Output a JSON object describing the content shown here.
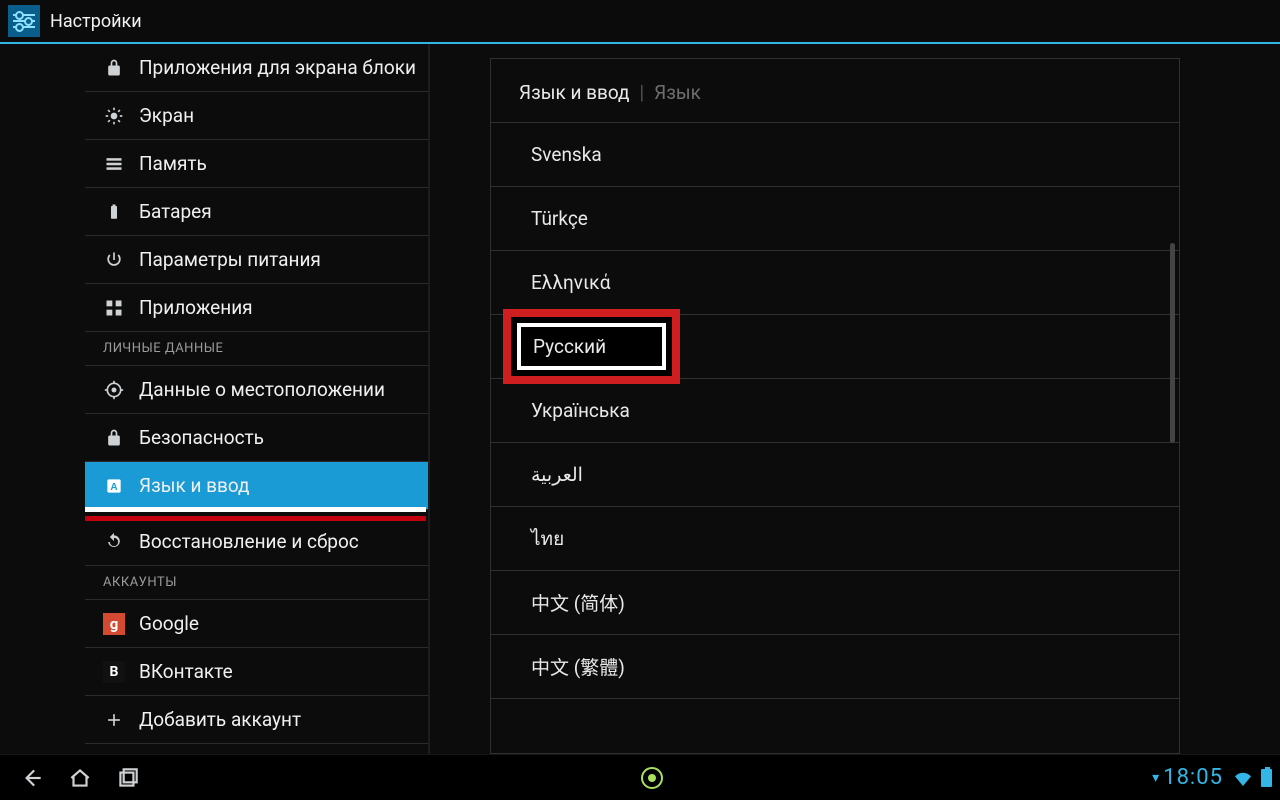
{
  "titlebar": {
    "title": "Настройки"
  },
  "sidebar": {
    "items": [
      {
        "icon": "lock",
        "label": "Приложения для экрана блоки"
      },
      {
        "icon": "brightness",
        "label": "Экран"
      },
      {
        "icon": "storage",
        "label": "Память"
      },
      {
        "icon": "battery",
        "label": "Батарея"
      },
      {
        "icon": "power",
        "label": "Параметры питания"
      },
      {
        "icon": "apps",
        "label": "Приложения"
      }
    ],
    "section_personal": "ЛИЧНЫЕ ДАННЫЕ",
    "personal": [
      {
        "icon": "location",
        "label": "Данные о местоположении"
      },
      {
        "icon": "security",
        "label": "Безопасность"
      },
      {
        "icon": "language",
        "label": "Язык и ввод",
        "selected": true
      },
      {
        "icon": "backup",
        "label": "Восстановление и сброс"
      }
    ],
    "section_accounts": "АККАУНТЫ",
    "accounts": [
      {
        "icon": "google",
        "glyph": "g",
        "label": "Google"
      },
      {
        "icon": "vk",
        "glyph": "B",
        "label": "ВКонтакте"
      },
      {
        "icon": "add",
        "label": "Добавить аккаунт"
      }
    ]
  },
  "detail": {
    "breadcrumb_main": "Язык и ввод",
    "breadcrumb_sub": "Язык",
    "languages": [
      "Svenska",
      "Türkçe",
      "Ελληνικά",
      "Русский",
      "Українська",
      "العربية",
      "ไทย",
      "中文 (简体)",
      "中文 (繁體)"
    ],
    "highlight_index": 3
  },
  "navbar": {
    "time": "18:05"
  }
}
